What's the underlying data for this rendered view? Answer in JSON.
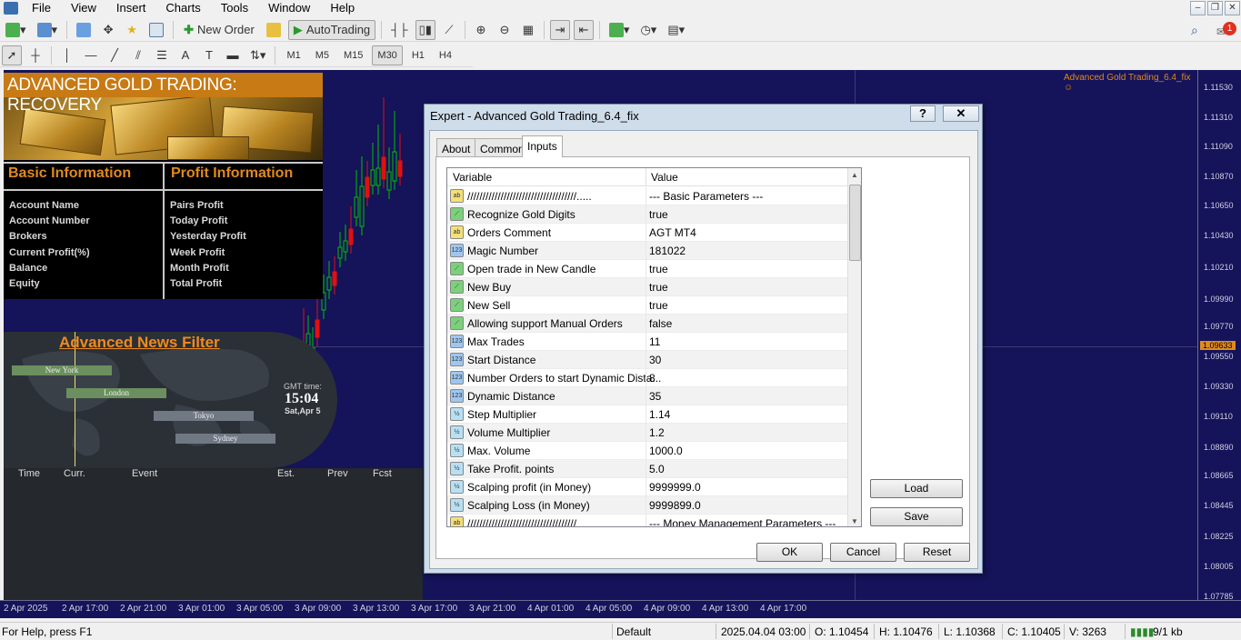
{
  "menu": [
    "File",
    "View",
    "Insert",
    "Charts",
    "Tools",
    "Window",
    "Help"
  ],
  "toolbar": {
    "new_order": "New Order",
    "autotrading": "AutoTrading"
  },
  "timeframes": [
    "M1",
    "M5",
    "M15",
    "M30",
    "H1",
    "H4"
  ],
  "active_timeframe": "M30",
  "notification_count": "1",
  "chart": {
    "ea_label": "Advanced Gold Trading_6.4_fix",
    "prices": [
      "1.11530",
      "1.11310",
      "1.11090",
      "1.10870",
      "1.10650",
      "1.10430",
      "1.10210",
      "1.09990",
      "1.09770",
      "1.09633",
      "1.09550",
      "1.09330",
      "1.09110",
      "1.08890",
      "1.08665",
      "1.08445",
      "1.08225",
      "1.08005",
      "1.07785"
    ],
    "current_price": "1.09633",
    "times": [
      "2 Apr 2025",
      "2 Apr 17:00",
      "2 Apr 21:00",
      "3 Apr 01:00",
      "3 Apr 05:00",
      "3 Apr 09:00",
      "3 Apr 13:00",
      "3 Apr 17:00",
      "3 Apr 21:00",
      "4 Apr 01:00",
      "4 Apr 05:00",
      "4 Apr 09:00",
      "4 Apr 13:00",
      "4 Apr 17:00"
    ]
  },
  "panel": {
    "banner_title": "ADVANCED GOLD TRADING: RECOVERY",
    "basic_title": "Basic Information",
    "profit_title": "Profit Information",
    "basic_items": [
      "Account Name",
      "Account Number",
      "Brokers",
      "Current Profit(%)",
      "Balance",
      "Equity"
    ],
    "profit_items": [
      "Pairs Profit",
      "Today Profit",
      "Yesterday Profit",
      "Week Profit",
      "Month Profit",
      "Total Profit"
    ]
  },
  "news": {
    "title": "Advanced News Filter",
    "cities": [
      "New York",
      "London",
      "Tokyo",
      "Sydney"
    ],
    "gmt_label": "GMT time:",
    "gmt_time": "15:04",
    "gmt_date": "Sat,Apr 5",
    "columns": [
      "Time",
      "Curr.",
      "Event",
      "Est.",
      "Prev",
      "Fcst"
    ]
  },
  "dialog": {
    "title": "Expert - Advanced Gold Trading_6.4_fix",
    "help": "?",
    "close": "✕",
    "tabs": [
      "About",
      "Common",
      "Inputs"
    ],
    "active_tab": "Inputs",
    "col_variable": "Variable",
    "col_value": "Value",
    "rows": [
      {
        "icon": "ab",
        "name": "////////////////////////////////////.....",
        "value": "--- Basic Parameters ---"
      },
      {
        "icon": "bool",
        "name": "Recognize Gold Digits",
        "value": "true"
      },
      {
        "icon": "ab",
        "name": "Orders Comment",
        "value": "AGT MT4"
      },
      {
        "icon": "123",
        "name": "Magic Number",
        "value": "181022"
      },
      {
        "icon": "bool",
        "name": "Open trade in New Candle",
        "value": "true"
      },
      {
        "icon": "bool",
        "name": "New Buy",
        "value": "true"
      },
      {
        "icon": "bool",
        "name": "New Sell",
        "value": "true"
      },
      {
        "icon": "bool",
        "name": "Allowing support Manual Orders",
        "value": "false"
      },
      {
        "icon": "123",
        "name": "Max Trades",
        "value": "11"
      },
      {
        "icon": "123",
        "name": "Start Distance",
        "value": "30"
      },
      {
        "icon": "123",
        "name": "Number Orders to start Dynamic Dista...",
        "value": "8"
      },
      {
        "icon": "123",
        "name": "Dynamic Distance",
        "value": "35"
      },
      {
        "icon": "dbl",
        "name": "Step Multiplier",
        "value": "1.14"
      },
      {
        "icon": "dbl",
        "name": "Volume Multiplier",
        "value": "1.2"
      },
      {
        "icon": "dbl",
        "name": "Max. Volume",
        "value": "1000.0"
      },
      {
        "icon": "dbl",
        "name": "Take Profit. points",
        "value": "5.0"
      },
      {
        "icon": "dbl",
        "name": "Scalping profit (in Money)",
        "value": "9999999.0"
      },
      {
        "icon": "dbl",
        "name": "Scalping Loss (in Money)",
        "value": "9999899.0"
      },
      {
        "icon": "ab",
        "name": "////////////////////////////////////",
        "value": "--- Money Management Parameters ---"
      }
    ],
    "load": "Load",
    "save": "Save",
    "ok": "OK",
    "cancel": "Cancel",
    "reset": "Reset"
  },
  "status": {
    "help": "For Help, press F1",
    "profile": "Default",
    "datetime": "2025.04.04 03:00",
    "open": "O: 1.10454",
    "high": "H: 1.10476",
    "low": "L: 1.10368",
    "close": "C: 1.10405",
    "volume": "V: 3263",
    "traffic": "9/1 kb"
  },
  "colors": {
    "chart_bg": "#15135a",
    "bull": "#00c000",
    "bear": "#e01010",
    "accent": "#e08a1e"
  }
}
